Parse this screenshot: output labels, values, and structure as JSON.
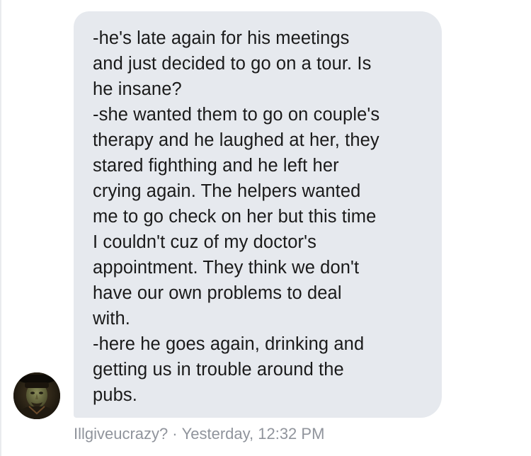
{
  "message": {
    "lines": [
      "-he's late again for his meetings",
      "and just decided to go on a tour. Is",
      "he insane?",
      "-she wanted them to go on couple's",
      "therapy and he laughed at her, they",
      "stared fighthing and he left her",
      "crying again. The helpers wanted",
      "me to go check on her but this time",
      "I couldn't cuz of my doctor's",
      "appointment. They think we don't",
      "have our own problems to deal",
      "with.",
      "-here he goes again, drinking and",
      "getting us in trouble around the",
      "pubs."
    ]
  },
  "sender": {
    "name": "Illgiveucrazy?",
    "separator": "·",
    "timestamp": "Yesterday, 12:32 PM",
    "avatar_icon": "user-avatar-photo"
  },
  "colors": {
    "bubble_bg": "#e6e9ee",
    "text": "#1a1a1a",
    "meta_text": "#90949c"
  }
}
